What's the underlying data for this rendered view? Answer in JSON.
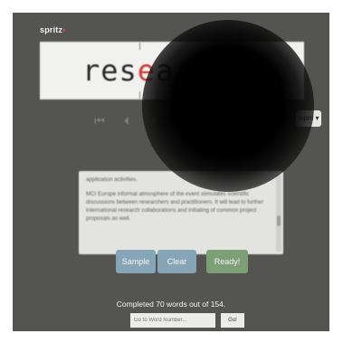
{
  "app": {
    "logo_text": "spritz",
    "logo_dot": "•"
  },
  "reader": {
    "word_before_orp": "res",
    "orp_letter": "e",
    "word_after_orp": "ar"
  },
  "controls": {
    "items": [
      {
        "name": "first-icon",
        "glyph": "⏮"
      },
      {
        "name": "previous-icon",
        "glyph": "⏴"
      },
      {
        "name": "pause-icon",
        "glyph": "⏸"
      }
    ],
    "wpm_label": "wpm ▾"
  },
  "text_panel": {
    "paragraph_1": "application activities.",
    "paragraph_2": "MCI Europe informal atmosphere of the event stimulates scientific discussions between researchers and practitioners. It will lead to further international research collaborations and initiating of common project proposals as well."
  },
  "buttons": {
    "sample": "Sample",
    "clear": "Clear",
    "ready": "Ready!"
  },
  "status": "Completed 70 words out of 154.",
  "goto": {
    "placeholder": "Go to Word Number...",
    "go_label": "Go!"
  },
  "colors": {
    "accent": "#cf3b33",
    "sample_button": "#86a5b7",
    "ready_button": "#7d9f77",
    "background": "#545450"
  }
}
